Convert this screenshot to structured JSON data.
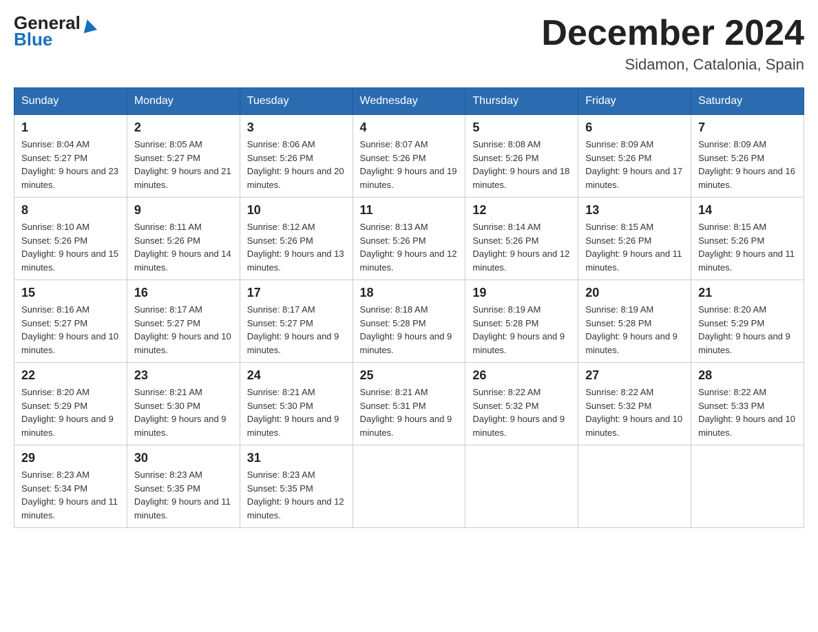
{
  "header": {
    "logo_text_general": "General",
    "logo_text_blue": "Blue",
    "month_title": "December 2024",
    "location": "Sidamon, Catalonia, Spain"
  },
  "weekdays": [
    "Sunday",
    "Monday",
    "Tuesday",
    "Wednesday",
    "Thursday",
    "Friday",
    "Saturday"
  ],
  "weeks": [
    [
      {
        "day": "1",
        "sunrise": "Sunrise: 8:04 AM",
        "sunset": "Sunset: 5:27 PM",
        "daylight": "Daylight: 9 hours and 23 minutes."
      },
      {
        "day": "2",
        "sunrise": "Sunrise: 8:05 AM",
        "sunset": "Sunset: 5:27 PM",
        "daylight": "Daylight: 9 hours and 21 minutes."
      },
      {
        "day": "3",
        "sunrise": "Sunrise: 8:06 AM",
        "sunset": "Sunset: 5:26 PM",
        "daylight": "Daylight: 9 hours and 20 minutes."
      },
      {
        "day": "4",
        "sunrise": "Sunrise: 8:07 AM",
        "sunset": "Sunset: 5:26 PM",
        "daylight": "Daylight: 9 hours and 19 minutes."
      },
      {
        "day": "5",
        "sunrise": "Sunrise: 8:08 AM",
        "sunset": "Sunset: 5:26 PM",
        "daylight": "Daylight: 9 hours and 18 minutes."
      },
      {
        "day": "6",
        "sunrise": "Sunrise: 8:09 AM",
        "sunset": "Sunset: 5:26 PM",
        "daylight": "Daylight: 9 hours and 17 minutes."
      },
      {
        "day": "7",
        "sunrise": "Sunrise: 8:09 AM",
        "sunset": "Sunset: 5:26 PM",
        "daylight": "Daylight: 9 hours and 16 minutes."
      }
    ],
    [
      {
        "day": "8",
        "sunrise": "Sunrise: 8:10 AM",
        "sunset": "Sunset: 5:26 PM",
        "daylight": "Daylight: 9 hours and 15 minutes."
      },
      {
        "day": "9",
        "sunrise": "Sunrise: 8:11 AM",
        "sunset": "Sunset: 5:26 PM",
        "daylight": "Daylight: 9 hours and 14 minutes."
      },
      {
        "day": "10",
        "sunrise": "Sunrise: 8:12 AM",
        "sunset": "Sunset: 5:26 PM",
        "daylight": "Daylight: 9 hours and 13 minutes."
      },
      {
        "day": "11",
        "sunrise": "Sunrise: 8:13 AM",
        "sunset": "Sunset: 5:26 PM",
        "daylight": "Daylight: 9 hours and 12 minutes."
      },
      {
        "day": "12",
        "sunrise": "Sunrise: 8:14 AM",
        "sunset": "Sunset: 5:26 PM",
        "daylight": "Daylight: 9 hours and 12 minutes."
      },
      {
        "day": "13",
        "sunrise": "Sunrise: 8:15 AM",
        "sunset": "Sunset: 5:26 PM",
        "daylight": "Daylight: 9 hours and 11 minutes."
      },
      {
        "day": "14",
        "sunrise": "Sunrise: 8:15 AM",
        "sunset": "Sunset: 5:26 PM",
        "daylight": "Daylight: 9 hours and 11 minutes."
      }
    ],
    [
      {
        "day": "15",
        "sunrise": "Sunrise: 8:16 AM",
        "sunset": "Sunset: 5:27 PM",
        "daylight": "Daylight: 9 hours and 10 minutes."
      },
      {
        "day": "16",
        "sunrise": "Sunrise: 8:17 AM",
        "sunset": "Sunset: 5:27 PM",
        "daylight": "Daylight: 9 hours and 10 minutes."
      },
      {
        "day": "17",
        "sunrise": "Sunrise: 8:17 AM",
        "sunset": "Sunset: 5:27 PM",
        "daylight": "Daylight: 9 hours and 9 minutes."
      },
      {
        "day": "18",
        "sunrise": "Sunrise: 8:18 AM",
        "sunset": "Sunset: 5:28 PM",
        "daylight": "Daylight: 9 hours and 9 minutes."
      },
      {
        "day": "19",
        "sunrise": "Sunrise: 8:19 AM",
        "sunset": "Sunset: 5:28 PM",
        "daylight": "Daylight: 9 hours and 9 minutes."
      },
      {
        "day": "20",
        "sunrise": "Sunrise: 8:19 AM",
        "sunset": "Sunset: 5:28 PM",
        "daylight": "Daylight: 9 hours and 9 minutes."
      },
      {
        "day": "21",
        "sunrise": "Sunrise: 8:20 AM",
        "sunset": "Sunset: 5:29 PM",
        "daylight": "Daylight: 9 hours and 9 minutes."
      }
    ],
    [
      {
        "day": "22",
        "sunrise": "Sunrise: 8:20 AM",
        "sunset": "Sunset: 5:29 PM",
        "daylight": "Daylight: 9 hours and 9 minutes."
      },
      {
        "day": "23",
        "sunrise": "Sunrise: 8:21 AM",
        "sunset": "Sunset: 5:30 PM",
        "daylight": "Daylight: 9 hours and 9 minutes."
      },
      {
        "day": "24",
        "sunrise": "Sunrise: 8:21 AM",
        "sunset": "Sunset: 5:30 PM",
        "daylight": "Daylight: 9 hours and 9 minutes."
      },
      {
        "day": "25",
        "sunrise": "Sunrise: 8:21 AM",
        "sunset": "Sunset: 5:31 PM",
        "daylight": "Daylight: 9 hours and 9 minutes."
      },
      {
        "day": "26",
        "sunrise": "Sunrise: 8:22 AM",
        "sunset": "Sunset: 5:32 PM",
        "daylight": "Daylight: 9 hours and 9 minutes."
      },
      {
        "day": "27",
        "sunrise": "Sunrise: 8:22 AM",
        "sunset": "Sunset: 5:32 PM",
        "daylight": "Daylight: 9 hours and 10 minutes."
      },
      {
        "day": "28",
        "sunrise": "Sunrise: 8:22 AM",
        "sunset": "Sunset: 5:33 PM",
        "daylight": "Daylight: 9 hours and 10 minutes."
      }
    ],
    [
      {
        "day": "29",
        "sunrise": "Sunrise: 8:23 AM",
        "sunset": "Sunset: 5:34 PM",
        "daylight": "Daylight: 9 hours and 11 minutes."
      },
      {
        "day": "30",
        "sunrise": "Sunrise: 8:23 AM",
        "sunset": "Sunset: 5:35 PM",
        "daylight": "Daylight: 9 hours and 11 minutes."
      },
      {
        "day": "31",
        "sunrise": "Sunrise: 8:23 AM",
        "sunset": "Sunset: 5:35 PM",
        "daylight": "Daylight: 9 hours and 12 minutes."
      },
      null,
      null,
      null,
      null
    ]
  ]
}
